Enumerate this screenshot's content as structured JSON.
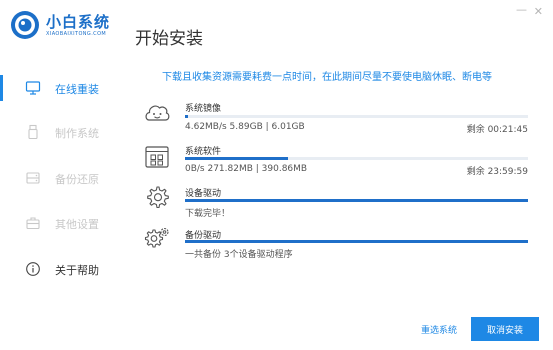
{
  "app": {
    "logo_title": "小白系统",
    "logo_subtitle": "XIAOBAIXITONG.COM"
  },
  "sidebar": {
    "items": [
      {
        "label": "在线重装",
        "icon": "monitor-icon",
        "active": true
      },
      {
        "label": "制作系统",
        "icon": "usb-drive-icon",
        "active": false
      },
      {
        "label": "备份还原",
        "icon": "backup-icon",
        "active": false
      },
      {
        "label": "其他设置",
        "icon": "toolbox-icon",
        "active": false
      },
      {
        "label": "关于帮助",
        "icon": "info-icon",
        "active": false
      }
    ]
  },
  "main": {
    "title": "开始安装",
    "notice": "下载且收集资源需要耗费一点时间，在此期间尽量不要使电脑休眠、断电等",
    "tasks": [
      {
        "name": "系统镜像",
        "icon": "smiley-cloud-icon",
        "detail": "4.62MB/s 5.89GB | 6.01GB",
        "remaining": "剩余 00:21:45",
        "progress": 0.01
      },
      {
        "name": "系统软件",
        "icon": "software-window-icon",
        "detail": "0B/s 271.82MB | 390.86MB",
        "remaining": "剩余 23:59:59",
        "progress": 0.3
      },
      {
        "name": "设备驱动",
        "icon": "gear-icon",
        "detail": "下载完毕！",
        "remaining": "",
        "progress": 1.0
      },
      {
        "name": "备份驱动",
        "icon": "gears-icon",
        "detail": "一共备份 3个设备驱动程序",
        "remaining": "",
        "progress": 1.0
      }
    ]
  },
  "footer": {
    "reselect_label": "重选系统",
    "cancel_label": "取消安装"
  },
  "window": {
    "minimize": "—",
    "close": "✕"
  },
  "colors": {
    "accent": "#1e88e5",
    "bar_fill": "#1f6fc9",
    "bar_track": "#e8edf3",
    "nav_inactive": "#c8c8c8"
  }
}
